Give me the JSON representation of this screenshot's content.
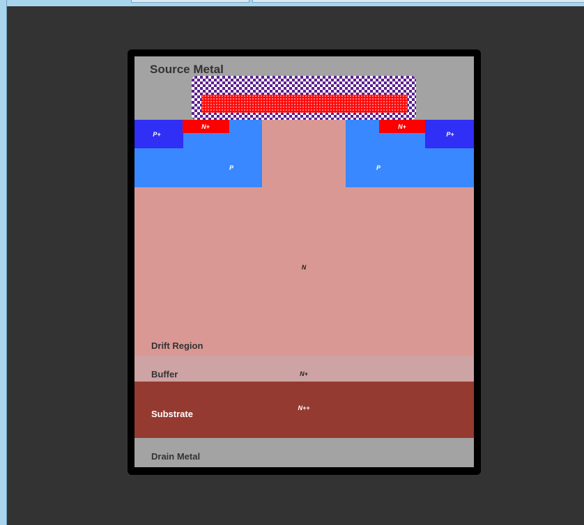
{
  "window": {
    "tabs": [
      "",
      ""
    ]
  },
  "diagram": {
    "layers": {
      "source_metal": "Source Metal",
      "drift_region": "Drift Region",
      "buffer": "Buffer",
      "substrate": "Substrate",
      "drain_metal": "Drain Metal"
    },
    "doping": {
      "p_plus_left": "P+",
      "n_plus_left": "N+",
      "p_left": "P",
      "n_plus_right": "N+",
      "p_plus_right": "P+",
      "p_right": "P",
      "drift_n": "N",
      "buffer_n_plus": "N+",
      "substrate_n_plus_plus": "N++"
    },
    "colors": {
      "background": "#333333",
      "frame": "#000000",
      "metal": "#a3a3a3",
      "p_plus": "#2f2ff5",
      "p_body": "#3a88ff",
      "n_plus": "#ff0000",
      "drift": "#da9894",
      "buffer": "#cea3a3",
      "substrate": "#943a31",
      "gate_oxide": "#5b1f8f",
      "gate_poly": "#ff0a0a"
    }
  }
}
